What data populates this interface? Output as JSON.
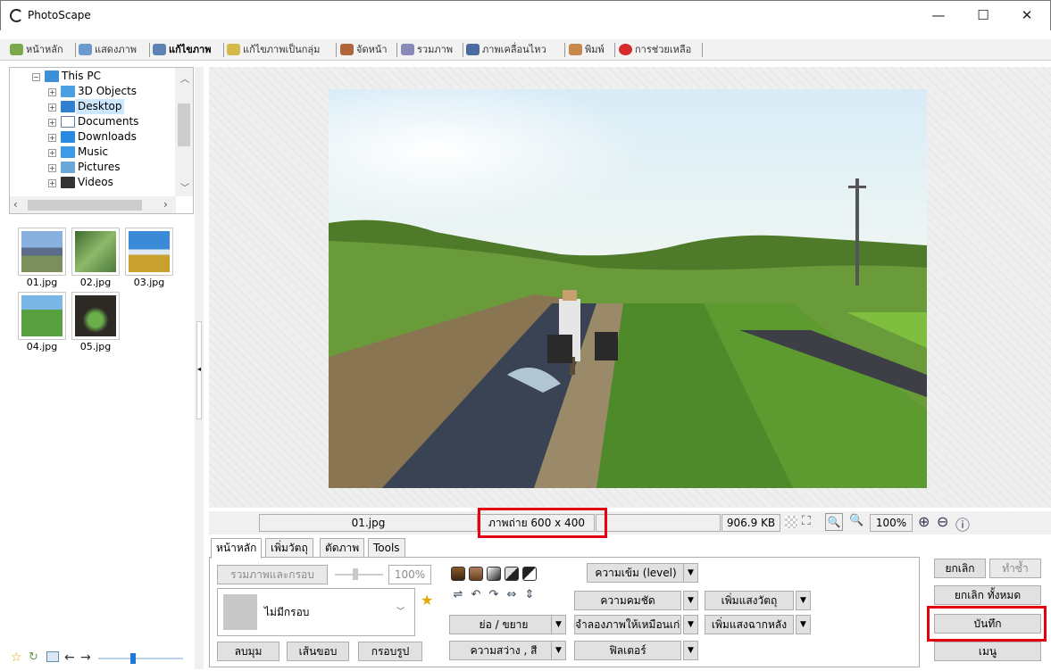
{
  "window": {
    "title": "PhotoScape",
    "min": "—",
    "max": "☐",
    "close": "✕"
  },
  "menu": {
    "items": [
      "หน้าหลัก",
      "แสดงภาพ",
      "แก้ไขภาพ",
      "แก้ไขภาพเป็นกลุ่ม",
      "จัดหน้า",
      "รวมภาพ",
      "ภาพเคลื่อนไหว",
      "พิมพ์",
      "การช่วยเหลือ"
    ]
  },
  "tree": {
    "root": "This PC",
    "items": [
      "3D Objects",
      "Desktop",
      "Documents",
      "Downloads",
      "Music",
      "Pictures",
      "Videos"
    ]
  },
  "thumbnails": [
    {
      "label": "01.jpg"
    },
    {
      "label": "02.jpg"
    },
    {
      "label": "03.jpg"
    },
    {
      "label": "04.jpg"
    },
    {
      "label": "05.jpg"
    }
  ],
  "status": {
    "filename": "01.jpg",
    "dimensions": "ภาพถ่าย 600 x 400",
    "filesize": "906.9 KB",
    "zoom": "100%"
  },
  "tabs": [
    "หน้าหลัก",
    "เพิ่มวัตถุ",
    "ตัดภาพ",
    "Tools"
  ],
  "editor": {
    "merge_frame": "รวมภาพและกรอบ",
    "frame_percent": "100%",
    "frame_select": "ไม่มีกรอบ",
    "round_corners": "ลบมุม",
    "border_line": "เส้นขอบ",
    "frame": "กรอบรูป",
    "level": "ความเข้ม (level)",
    "sharpen": "ความคมชัด",
    "resize": "ย่อ / ขยาย",
    "simulate": "จำลองภาพให้เหมือนเก่า",
    "brightness": "ความสว่าง , สี",
    "filter": "ฟิลเตอร์",
    "backlight_obj": "เพิ่มแสงวัตถุ",
    "backlight_bg": "เพิ่มแสงฉากหลัง"
  },
  "actions": {
    "undo": "ยกเลิก",
    "redo": "ทำซ้ำ",
    "undo_all": "ยกเลิก ทั้งหมด",
    "save": "บันทึก",
    "menu": "เมนู"
  },
  "colors": {
    "highlight": "#e3000f",
    "selected_item": "#cce8ff"
  }
}
